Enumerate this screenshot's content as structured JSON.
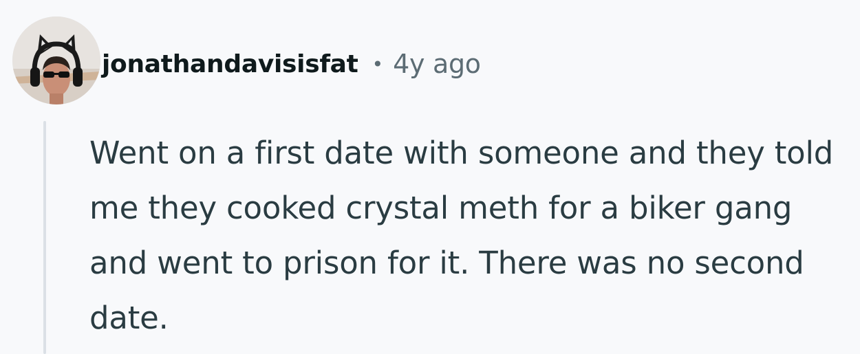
{
  "comment": {
    "author": "jonathandavisisfat",
    "separator": "•",
    "timestamp": "4y ago",
    "body": "Went on a first date with someone and they told me they cooked crystal meth for a biker gang and went to prison for it. There was no second date."
  },
  "colors": {
    "background": "#f8f9fb",
    "username": "#0f1a1c",
    "meta_text": "#5c6c74",
    "body_text": "#2a3c42",
    "thread_line": "#dbe0e6"
  },
  "avatar": {
    "icon": "user-avatar-cat-ears-headphones-sunglasses"
  }
}
